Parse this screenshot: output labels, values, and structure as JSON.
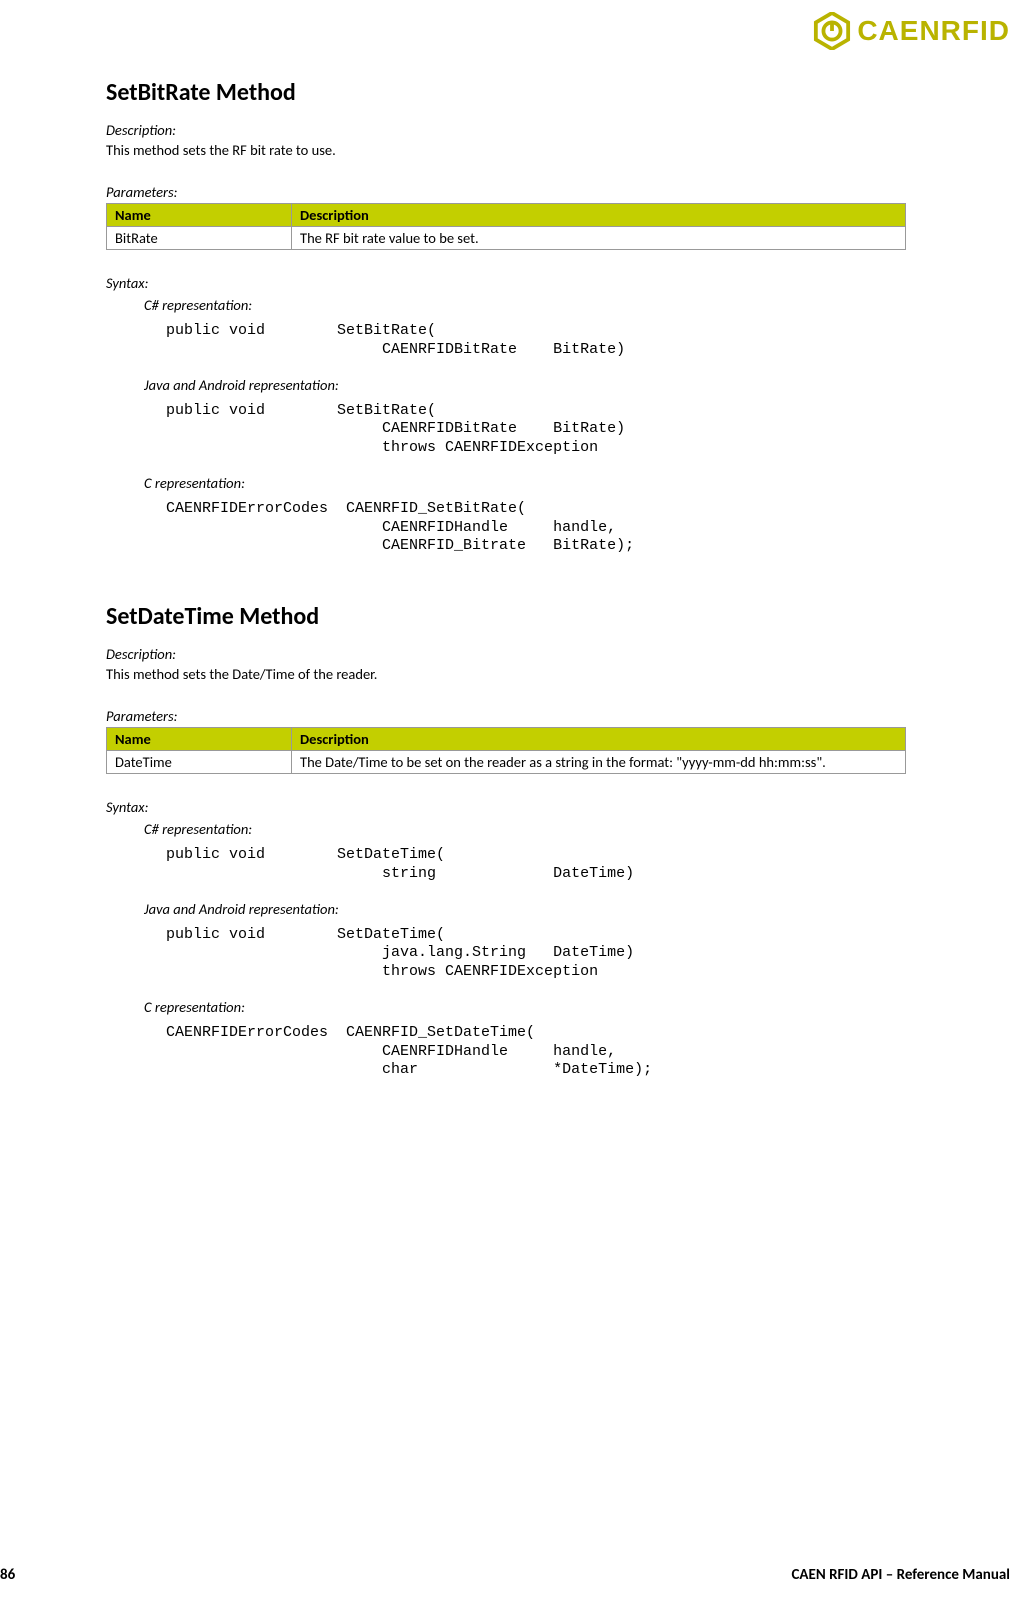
{
  "logo": {
    "text": "CAENRFID"
  },
  "sections": [
    {
      "title": "SetBitRate Method",
      "description_label": "Description:",
      "description": "This method sets the RF bit rate to use.",
      "parameters_label": "Parameters:",
      "param_headers": {
        "name": "Name",
        "desc": "Description"
      },
      "params": [
        {
          "name": "BitRate",
          "desc": "The RF bit rate value to be set."
        }
      ],
      "syntax_label": "Syntax:",
      "reps": [
        {
          "label": "C# representation:",
          "code": "public void        SetBitRate(\n                        CAENRFIDBitRate    BitRate)"
        },
        {
          "label": "Java and Android representation:",
          "code": "public void        SetBitRate(\n                        CAENRFIDBitRate    BitRate)\n                        throws CAENRFIDException"
        },
        {
          "label": "C representation:",
          "code": "CAENRFIDErrorCodes  CAENRFID_SetBitRate(\n                        CAENRFIDHandle     handle,\n                        CAENRFID_Bitrate   BitRate);"
        }
      ]
    },
    {
      "title": "SetDateTime Method",
      "description_label": "Description:",
      "description": "This method sets the Date/Time of the reader.",
      "parameters_label": "Parameters:",
      "param_headers": {
        "name": "Name",
        "desc": "Description"
      },
      "params": [
        {
          "name": "DateTime",
          "desc": "The Date/Time to be set on the reader as a string in the format: \"yyyy-mm-dd hh:mm:ss\"."
        }
      ],
      "syntax_label": "Syntax:",
      "reps": [
        {
          "label": "C# representation:",
          "code": "public void        SetDateTime(\n                        string             DateTime)"
        },
        {
          "label": "Java and Android representation:",
          "code": "public void        SetDateTime(\n                        java.lang.String   DateTime)\n                        throws CAENRFIDException"
        },
        {
          "label": "C representation:",
          "code": "CAENRFIDErrorCodes  CAENRFID_SetDateTime(\n                        CAENRFIDHandle     handle,\n                        char               *DateTime);"
        }
      ]
    }
  ],
  "footer": {
    "page": "86",
    "title": "CAEN RFID API – Reference Manual"
  }
}
